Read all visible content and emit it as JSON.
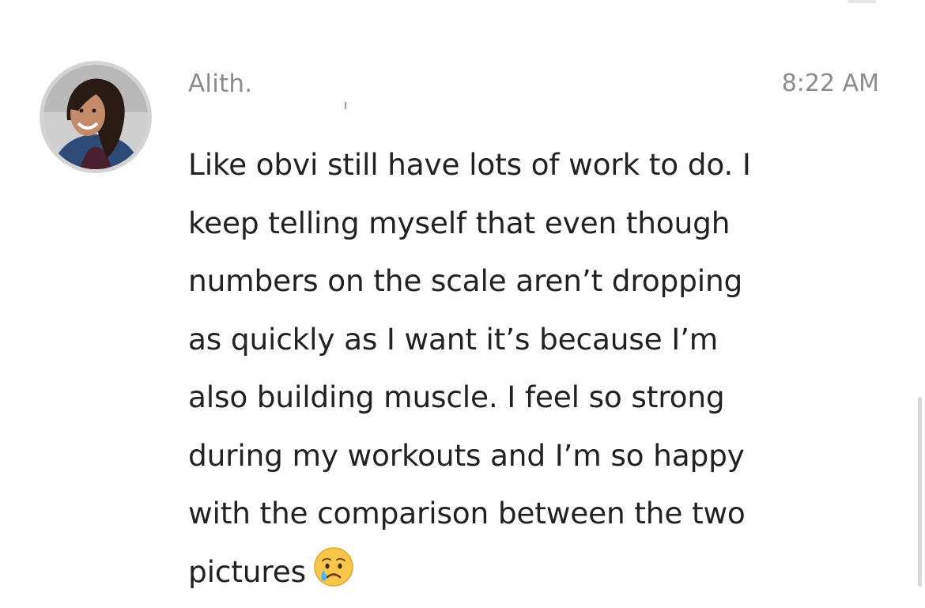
{
  "message": {
    "sender": "Alith.",
    "timestamp": "8:22 AM",
    "lines": [
      "Like obvi still have lots of work to do. I",
      "keep telling myself that even though",
      "numbers on the scale aren’t dropping",
      "as quickly as I want it’s because I’m",
      "also building muscle. I feel so strong",
      "during my workouts and I’m so happy",
      "with the comparison between the two",
      "pictures"
    ],
    "trailing_emoji": "crying-face-emoji"
  }
}
